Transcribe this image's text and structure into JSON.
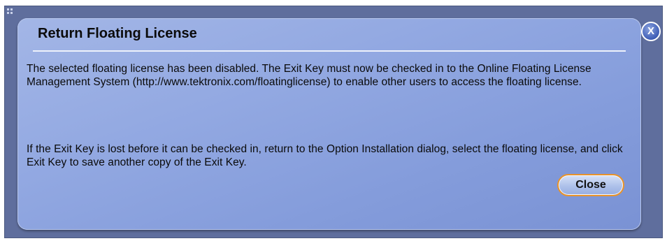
{
  "dialog": {
    "title": "Return Floating License",
    "message_1": "The selected floating license has been disabled. The Exit Key must now be checked in to the Online Floating License Management System (http://www.tektronix.com/floatinglicense) to enable other users to access the floating license.",
    "message_2": "If the Exit Key is lost before it can be checked in, return to the Option Installation dialog, select the floating license, and click Exit Key to save another copy of the Exit Key.",
    "close_label": "Close",
    "x_label": "X"
  },
  "colors": {
    "frame": "#5f6e9d",
    "panel": "#93a9e2",
    "button_border": "#e8932b",
    "x_button": "#3e5db6"
  }
}
